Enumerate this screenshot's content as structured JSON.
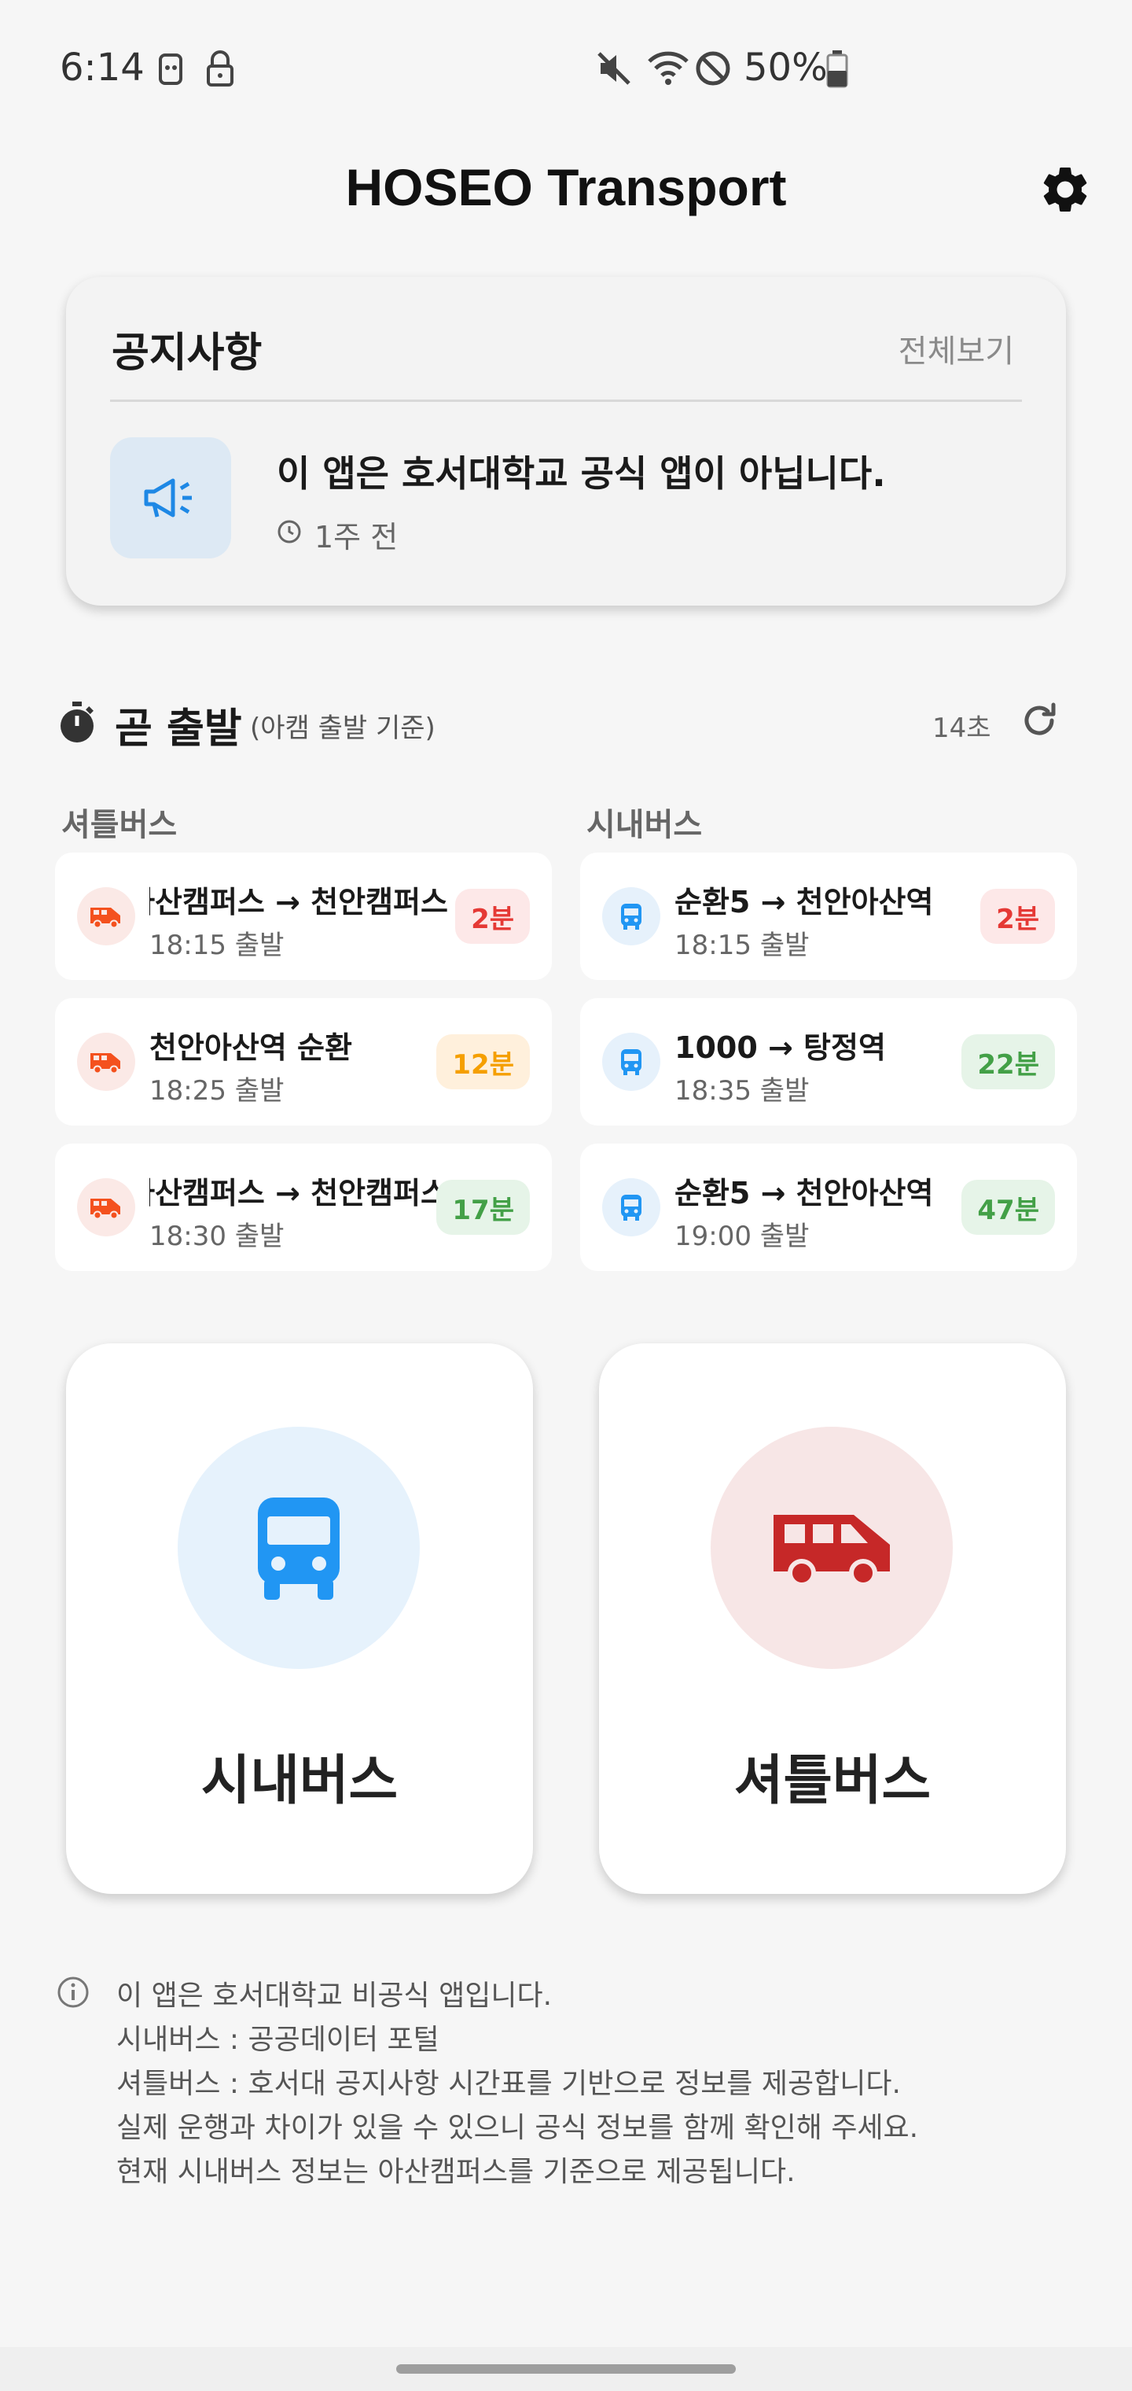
{
  "status_bar": {
    "time": "6:14",
    "battery": "50%"
  },
  "app": {
    "title": "HOSEO Transport"
  },
  "notice": {
    "title": "공지사항",
    "view_all": "전체보기",
    "message": "이 앱은 호서대학교 공식 앱이 아닙니다.",
    "time_ago": "1주 전"
  },
  "departing_soon": {
    "title": "곧 출발",
    "subtitle": "(아캠 출발 기준)",
    "refresh_seconds": "14초",
    "shuttle_label": "셔틀버스",
    "city_label": "시내버스",
    "shuttle": [
      {
        "route": "아산캠퍼스 → 천안캠퍼스",
        "time": "18:15 출발",
        "badge": "2분",
        "color": "red"
      },
      {
        "route": "천안아산역 순환",
        "time": "18:25 출발",
        "badge": "12분",
        "color": "orange"
      },
      {
        "route": "아산캠퍼스 → 천안캠퍼스",
        "time": "18:30 출발",
        "badge": "17분",
        "color": "green"
      }
    ],
    "city": [
      {
        "route": "순환5 → 천안아산역",
        "time": "18:15 출발",
        "badge": "2분",
        "color": "red"
      },
      {
        "route": "1000 → 탕정역",
        "time": "18:35 출발",
        "badge": "22분",
        "color": "green"
      },
      {
        "route": "순환5 → 천안아산역",
        "time": "19:00 출발",
        "badge": "47분",
        "color": "green"
      }
    ]
  },
  "main_buttons": {
    "city_bus": "시내버스",
    "shuttle_bus": "셔틀버스"
  },
  "info": {
    "lines": [
      "이 앱은 호서대학교 비공식 앱입니다.",
      "시내버스 : 공공데이터 포털",
      "셔틀버스 : 호서대 공지사항 시간표를 기반으로 정보를 제공합니다.",
      "실제 운행과 차이가 있을 수 있으니 공식 정보를 함께 확인해 주세요.",
      "현재 시내버스 정보는 아산캠퍼스를 기준으로 제공됩니다."
    ]
  },
  "colors": {
    "accent_blue": "#2196f3",
    "shuttle_red": "#c62828",
    "shuttle_orange": "#f4511e"
  }
}
